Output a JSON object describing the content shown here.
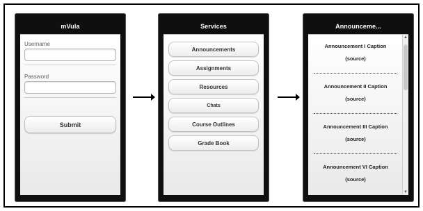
{
  "screens": {
    "login": {
      "title": "mVula",
      "username_label": "Username",
      "username_value": "",
      "password_label": "Password",
      "password_value": "",
      "submit_label": "Submit"
    },
    "services": {
      "title": "Services",
      "buttons": [
        {
          "label": "Announcements"
        },
        {
          "label": "Assignments"
        },
        {
          "label": "Resources"
        },
        {
          "label": "Chats"
        },
        {
          "label": "Course Outlines"
        },
        {
          "label": "Grade Book"
        }
      ]
    },
    "announcements": {
      "title": "Announceme...",
      "items": [
        {
          "caption": "Announcement I Caption",
          "source": "(source)"
        },
        {
          "caption": "Announcement II Caption",
          "source": "(source)"
        },
        {
          "caption": "Announcement III Caption",
          "source": "(source)"
        },
        {
          "caption": "Announcement VI Caption",
          "source": "(source)"
        }
      ]
    }
  },
  "icons": {
    "arrow": "arrow-right-icon",
    "scroll_up": "scroll-up-icon",
    "scroll_down": "scroll-down-icon"
  }
}
